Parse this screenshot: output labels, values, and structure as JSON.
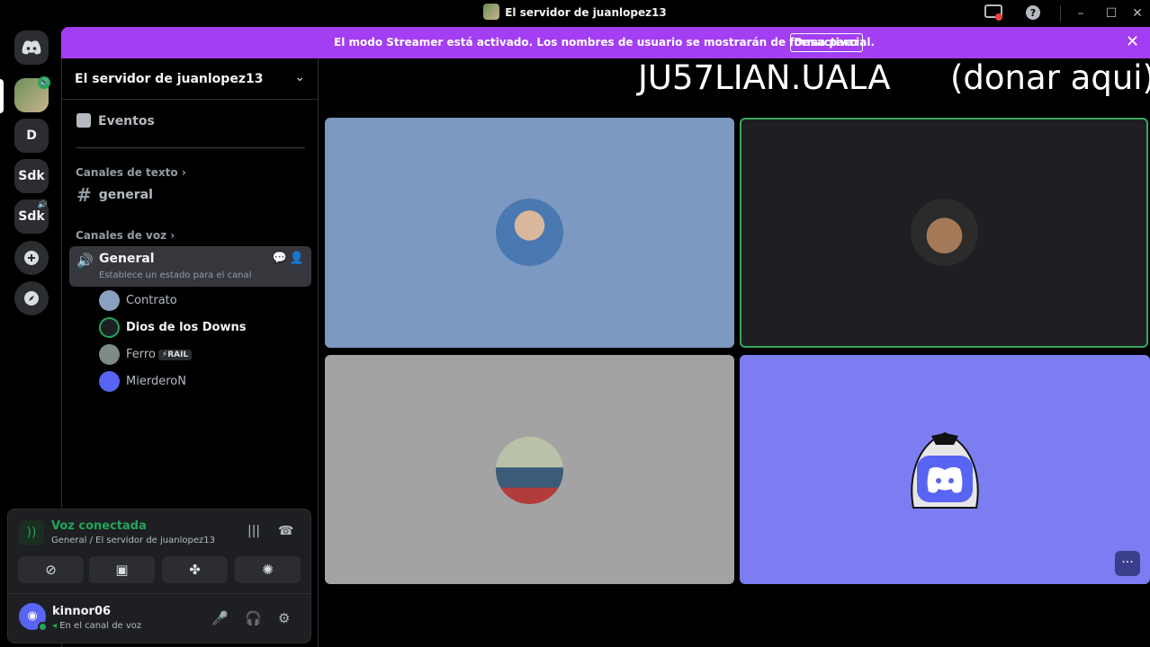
{
  "window": {
    "title": "El servidor de juanlopez13",
    "controls": [
      "inbox-icon",
      "help-icon",
      "minimize-icon",
      "maximize-icon",
      "close-icon"
    ]
  },
  "server_rail": {
    "items": [
      {
        "label": "",
        "icon": "discord-home-icon"
      },
      {
        "label": "",
        "icon": "server-avatar"
      },
      {
        "label": "D"
      },
      {
        "label": "Sdk"
      },
      {
        "label": "Sdk"
      },
      {
        "label": "",
        "icon": "add-server-icon"
      },
      {
        "label": "",
        "icon": "discover-icon"
      }
    ]
  },
  "banner": {
    "text": "El modo Streamer está activado. Los nombres de usuario se mostrarán de forma parcial.",
    "button": "Desactivar"
  },
  "sidebar": {
    "server_name": "El servidor de juanlopez13",
    "events": "Eventos",
    "text_category": "Canales de texto",
    "text_channel": "general",
    "voice_category": "Canales de voz",
    "voice_channel": "General",
    "voice_status": "Establece un estado para el canal",
    "members": [
      {
        "name": "Contrato",
        "avatar_color": "#8aa0c0"
      },
      {
        "name": "Dios de los Downs",
        "avatar_color": "#1e1f22",
        "speaking": true
      },
      {
        "name": "Ferro",
        "avatar_color": "#7d8a86",
        "badge": "⚡RAIL"
      },
      {
        "name": "MierderoN",
        "avatar_color": "#5865f2"
      }
    ]
  },
  "voice_panel": {
    "status": "Voz conectada",
    "location": "General / El servidor de juanlopez13",
    "buttons": [
      "camera-off-icon",
      "screen-share-icon",
      "activities-icon",
      "soundboard-icon"
    ]
  },
  "user": {
    "name": "kinnor06",
    "status": "En el canal de voz"
  },
  "stage": {
    "overlay_left": "JU57LIAN.UALA",
    "overlay_right": "(donar aqui)",
    "tiles": [
      {
        "bg": "#7b99c1",
        "avatar": "#4a78b0",
        "speaking": false
      },
      {
        "bg": "#1e1f22",
        "avatar": "#2b2b2b",
        "speaking": true
      },
      {
        "bg": "#a3a3a3",
        "avatar": "#b9c2a8",
        "speaking": false
      },
      {
        "bg": "#7c7df0",
        "avatar": "#5865f2",
        "speaking": false
      }
    ]
  }
}
